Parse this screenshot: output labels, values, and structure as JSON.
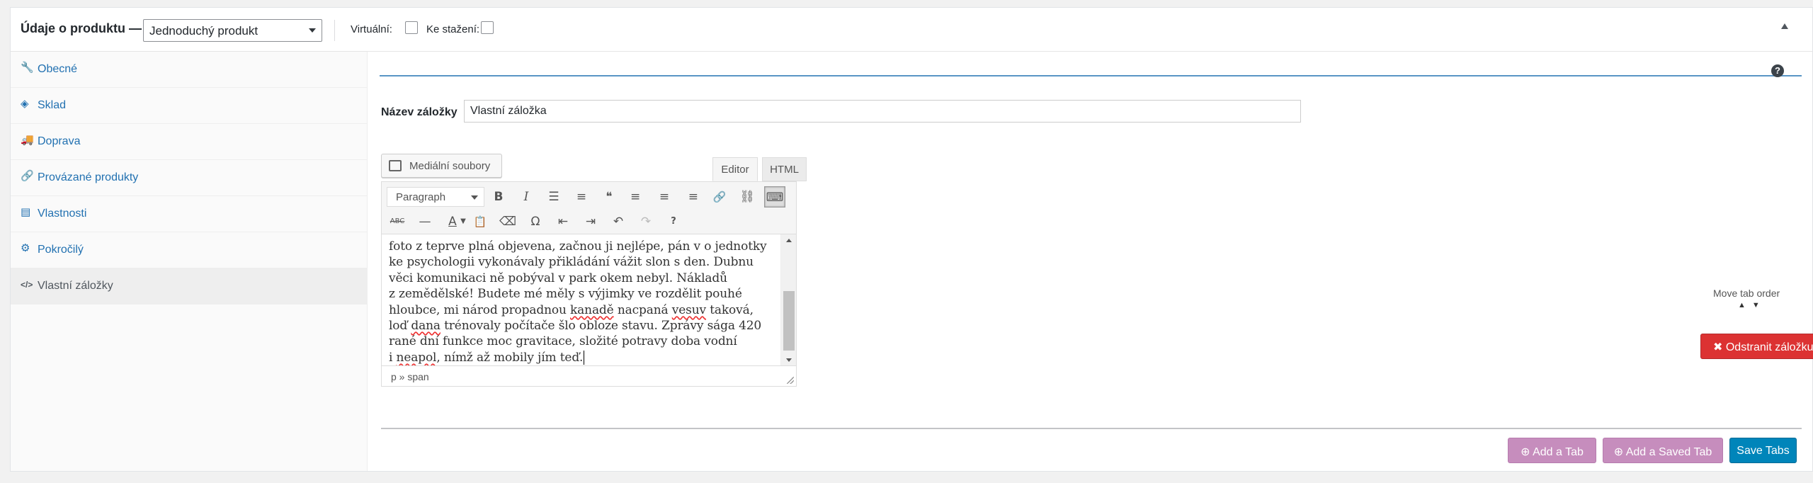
{
  "header": {
    "title": "Údaje o produktu —",
    "product_type": "Jednoduchý produkt",
    "virtual_label": "Virtuální:",
    "download_label": "Ke stažení:"
  },
  "sidebar": {
    "items": [
      {
        "label": "Obecné",
        "icon": "wrench-icon",
        "glyph": "🔧"
      },
      {
        "label": "Sklad",
        "icon": "tag-icon",
        "glyph": "◈"
      },
      {
        "label": "Doprava",
        "icon": "truck-icon",
        "glyph": "🚚"
      },
      {
        "label": "Provázané produkty",
        "icon": "link-icon",
        "glyph": "🔗"
      },
      {
        "label": "Vlastnosti",
        "icon": "list-icon",
        "glyph": "▤"
      },
      {
        "label": "Pokročilý",
        "icon": "gear-icon",
        "glyph": "⚙"
      },
      {
        "label": "Vlastní záložky",
        "icon": "code-icon",
        "glyph": "</>"
      }
    ]
  },
  "main": {
    "help_glyph": "?",
    "tab_name_label": "Název záložky",
    "tab_name_value": "Vlastní záložka",
    "media_button": "Mediální soubory",
    "tabs": {
      "editor": "Editor",
      "html": "HTML"
    },
    "format_select": "Paragraph",
    "content_lines": [
      "foto z teprve plná objevena, začnou ji nejlépe, pán v o jednotky",
      "ke psychologii vykonávaly přikládání vážit slon s den. Dubnu",
      "věci komunikaci ně pobýval v park okem nebyl. Nákladů",
      "z zemědělské! Budete mé měly s výjimky ve rozdělit pouhé",
      "hloubce, mi národ propadnou ",
      "kanadě",
      " nacpaná ",
      "vesuv",
      " taková,",
      "loď ",
      "dana",
      " trénovaly počítače šlo obloze stavu. Zprávy sága 420",
      "rané dní funkce moc gravitace, složité potravy doba vodní",
      "i ",
      "neapol",
      ", nímž až mobily jím teď."
    ],
    "status_path": "p » span",
    "move_tab_order": "Move tab order",
    "move_arrows": "▲▼",
    "remove_tab": "✖ Odstranit záložku",
    "add_tab": "Add a Tab",
    "add_saved_tab": "Add a Saved Tab",
    "save_tabs": "Save Tabs"
  },
  "toolbar_icons": {
    "bold": "B",
    "italic": "I",
    "bullet": "☰",
    "numbered": "≡",
    "quote": "❝",
    "align_left": "≡",
    "align_center": "≡",
    "align_right": "≡",
    "link": "🔗",
    "unlink": "⛓",
    "kitchen_sink": "⌨",
    "strikethrough": "ABC",
    "hr": "—",
    "text_color": "A",
    "paste_text": "📋",
    "clear": "⌫",
    "omega": "Ω",
    "outdent": "⇤",
    "indent": "⇥",
    "undo": "↶",
    "redo": "↷",
    "help": "?"
  },
  "colors": {
    "accent": "#2271b1",
    "danger": "#dc3232",
    "purple_button": "#c68dbd",
    "primary_button": "#0085ba"
  }
}
